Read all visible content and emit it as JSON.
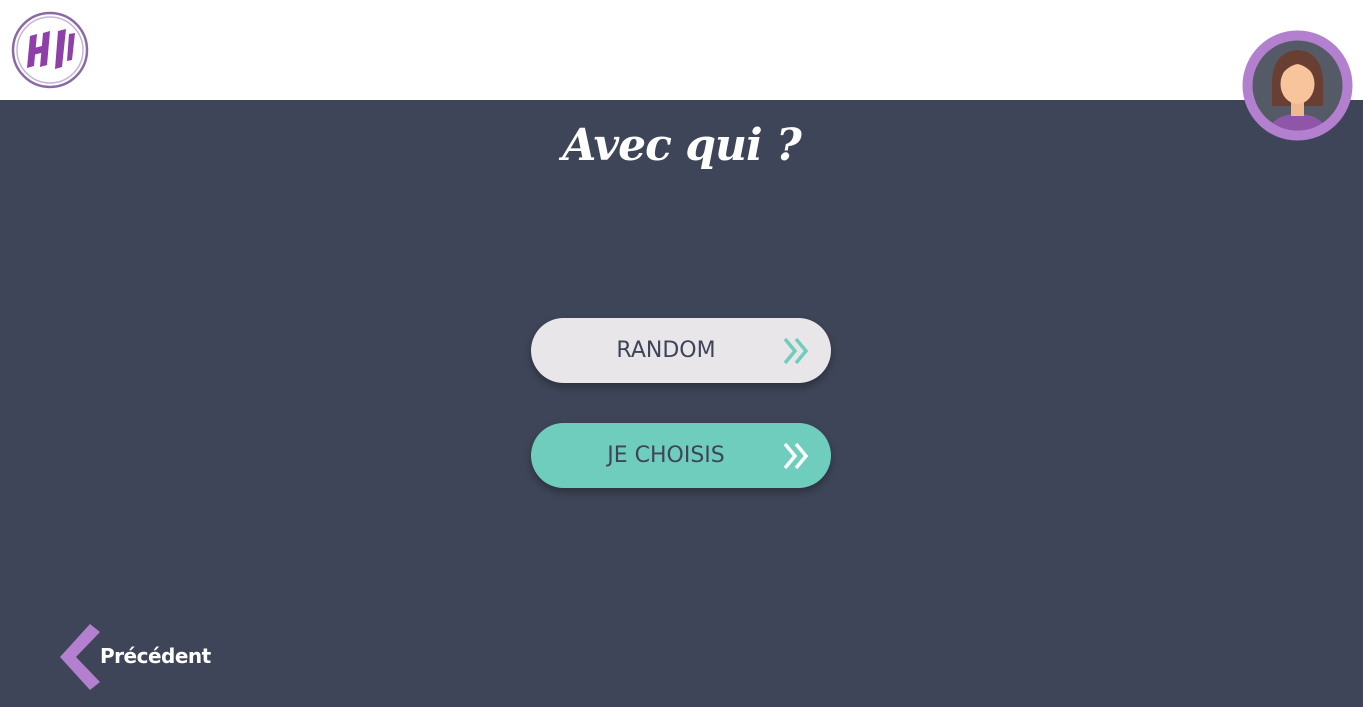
{
  "header": {
    "logo_icon": "hi-logo-icon",
    "avatar_icon": "user-avatar-icon"
  },
  "main": {
    "title": "Avec qui ?",
    "options": [
      {
        "label": "RANDOM",
        "icon": "double-chevron-right-icon"
      },
      {
        "label": "JE CHOISIS",
        "icon": "double-chevron-right-icon"
      }
    ]
  },
  "footer": {
    "back_label": "Précédent",
    "back_icon": "chevron-left-icon"
  },
  "colors": {
    "background": "#3e4558",
    "header_background": "#ffffff",
    "accent_purple": "#b37fcf",
    "accent_teal": "#6fcdbd",
    "button_light": "#e9e6ea",
    "text_dark": "#3e4558"
  }
}
